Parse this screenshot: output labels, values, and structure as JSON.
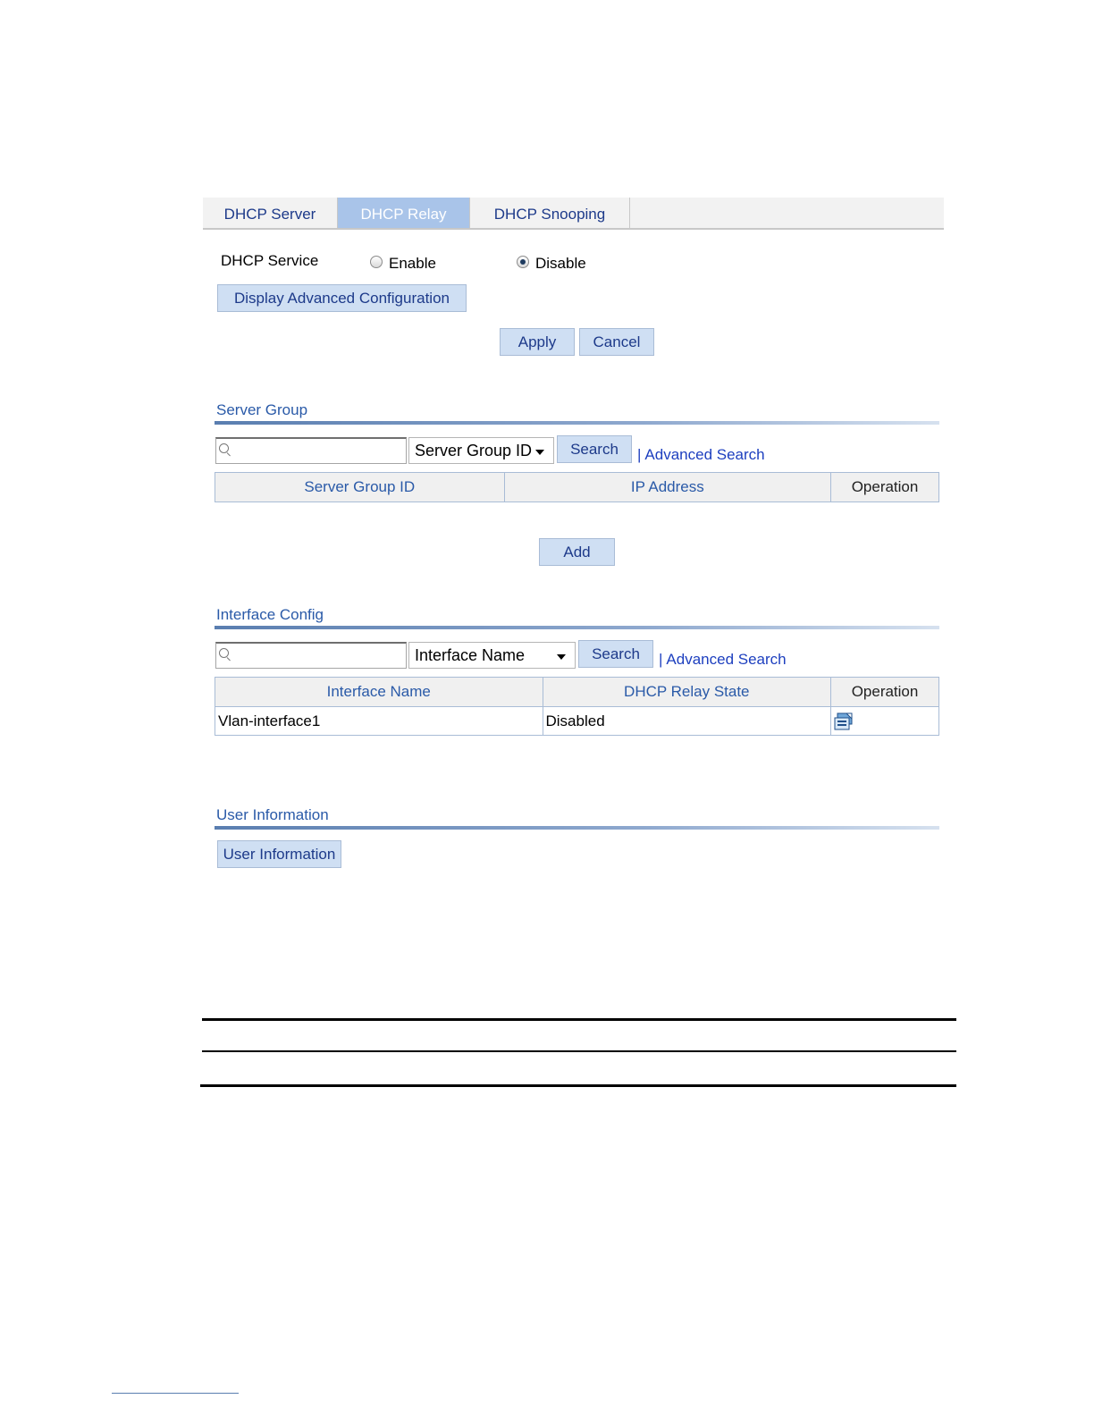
{
  "tabs": [
    {
      "label": "DHCP Server"
    },
    {
      "label": "DHCP Relay",
      "active": true
    },
    {
      "label": "DHCP Snooping"
    }
  ],
  "service": {
    "label": "DHCP Service",
    "enable_label": "Enable",
    "disable_label": "Disable",
    "selected": "Disable"
  },
  "advanced_config_button": "Display Advanced Configuration",
  "apply_button": "Apply",
  "cancel_button": "Cancel",
  "server_group": {
    "title": "Server Group",
    "search_value": "",
    "field_select": "Server Group ID",
    "search_button": "Search",
    "separator": "|",
    "advanced_search": "Advanced Search",
    "columns": [
      "Server Group ID",
      "IP Address",
      "Operation"
    ],
    "rows": [],
    "add_button": "Add"
  },
  "interface_config": {
    "title": "Interface Config",
    "search_value": "",
    "field_select": "Interface Name",
    "search_button": "Search",
    "separator": "|",
    "advanced_search": "Advanced Search",
    "columns": [
      "Interface Name",
      "DHCP Relay State",
      "Operation"
    ],
    "rows": [
      {
        "interface": "Vlan-interface1",
        "state": "Disabled",
        "operation_icon": "edit-config-icon"
      }
    ]
  },
  "user_information": {
    "title": "User Information",
    "button": "User Information"
  }
}
